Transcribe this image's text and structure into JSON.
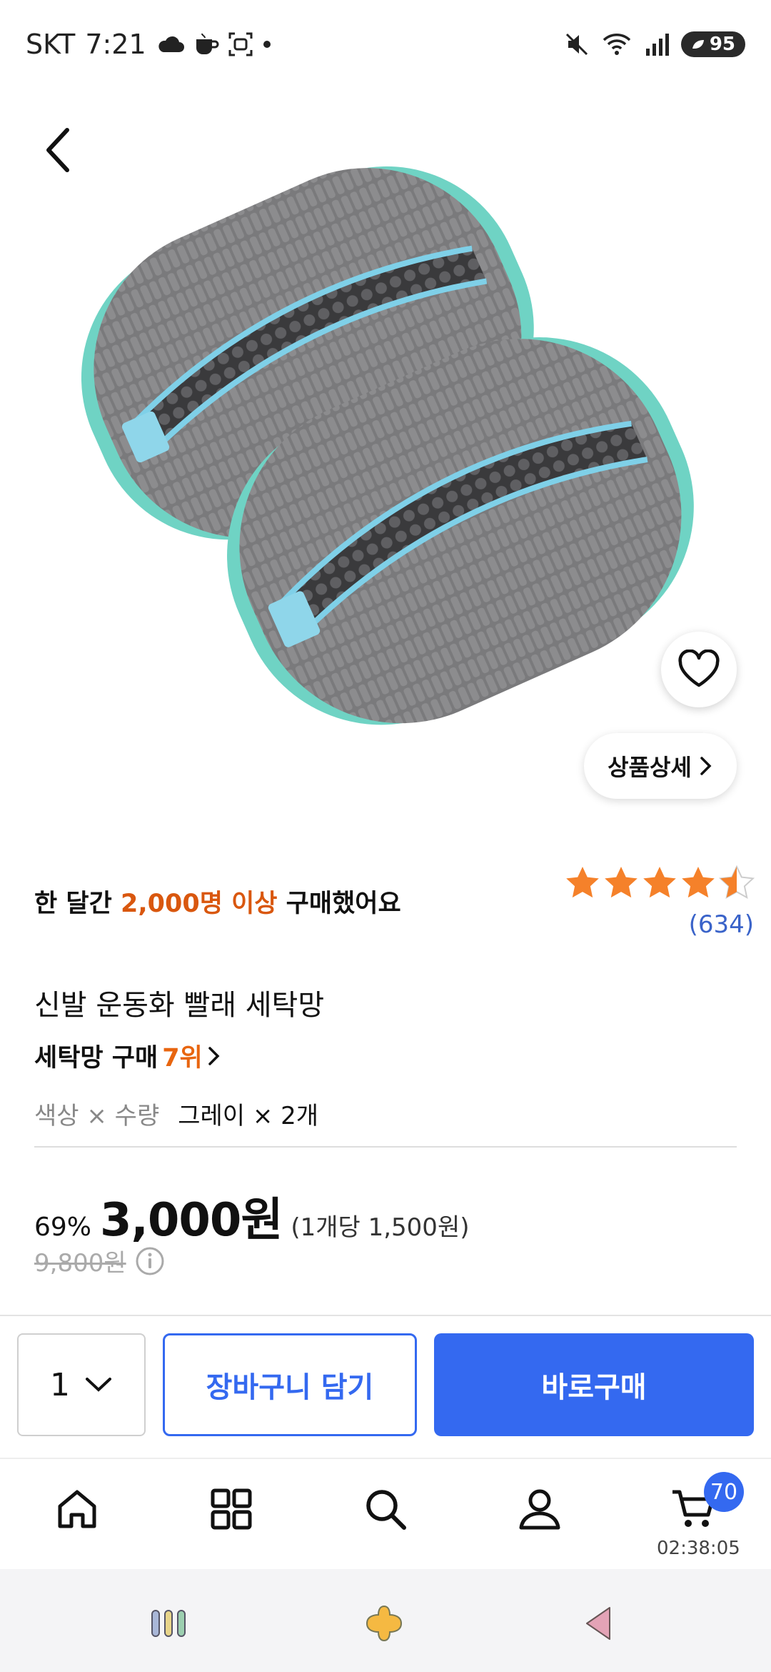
{
  "status_bar": {
    "carrier": "SKT",
    "time": "7:21",
    "battery": "95"
  },
  "product": {
    "detail_button_label": "상품상세",
    "bought_prefix": "한 달간 ",
    "bought_highlight": "2,000명 이상",
    "bought_suffix": " 구매했어요",
    "rating": 4.5,
    "review_count": "(634)",
    "title": "신발 운동화 빨래 세탁망",
    "rank_category": "세탁망 구매 ",
    "rank_number": "7위",
    "option_label": "색상 × 수량",
    "option_value": "그레이 × 2개",
    "discount_percent": "69%",
    "price": "3,000원",
    "unit_price": "(1개당 1,500원)",
    "original_price": "9,800원"
  },
  "purchase_bar": {
    "quantity": "1",
    "cart_label": "장바구니 담기",
    "buy_label": "바로구매"
  },
  "tabbar": {
    "cart_badge": "70",
    "timer": "02:38:05"
  },
  "colors": {
    "accent_blue": "#3469f0",
    "highlight_orange": "#d9570e",
    "star_orange": "#f5812a"
  },
  "icons": [
    "back-icon",
    "heart-icon",
    "chevron-right-icon",
    "info-icon",
    "chevron-down-icon",
    "home-icon",
    "categories-icon",
    "search-icon",
    "profile-icon",
    "cart-icon"
  ]
}
